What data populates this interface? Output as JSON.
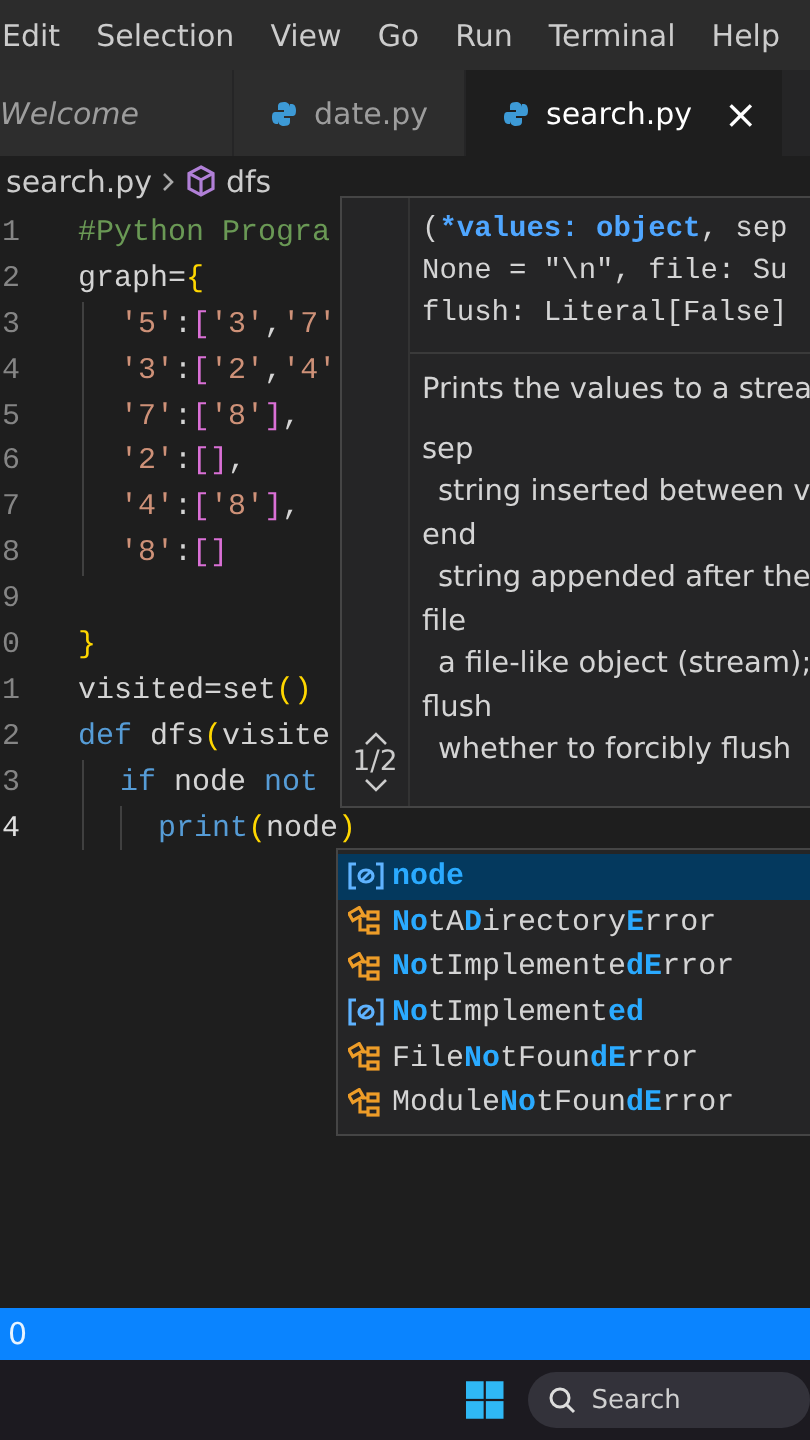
{
  "menu": [
    "Edit",
    "Selection",
    "View",
    "Go",
    "Run",
    "Terminal",
    "Help"
  ],
  "tabs": [
    {
      "label": "Welcome",
      "kind": "preview",
      "selected": false,
      "closable": false
    },
    {
      "label": "date.py",
      "kind": "python",
      "selected": false,
      "closable": false
    },
    {
      "label": "search.py",
      "kind": "python",
      "selected": true,
      "closable": true,
      "close": "×"
    }
  ],
  "breadcrumb": {
    "file": "search.py",
    "symbol": "dfs"
  },
  "code": [
    {
      "number": "1",
      "active": false,
      "kind": "top",
      "tokens": [
        {
          "kind": "comment",
          "text": "#Python Progra"
        }
      ]
    },
    {
      "number": "2",
      "active": false,
      "kind": "top",
      "tokens": [
        {
          "kind": "plain",
          "text": "graph="
        },
        {
          "kind": "bracket1",
          "text": "{"
        }
      ]
    },
    {
      "number": "3",
      "active": false,
      "kind": "block",
      "tokens": [
        {
          "kind": "string",
          "text": "'5'"
        },
        {
          "kind": "plain",
          "text": ":"
        },
        {
          "kind": "bracket2",
          "text": "["
        },
        {
          "kind": "string",
          "text": "'3'"
        },
        {
          "kind": "plain",
          "text": ","
        },
        {
          "kind": "string",
          "text": "'7'"
        }
      ]
    },
    {
      "number": "4",
      "active": false,
      "kind": "block",
      "tokens": [
        {
          "kind": "string",
          "text": "'3'"
        },
        {
          "kind": "plain",
          "text": ":"
        },
        {
          "kind": "bracket2",
          "text": "["
        },
        {
          "kind": "string",
          "text": "'2'"
        },
        {
          "kind": "plain",
          "text": ","
        },
        {
          "kind": "string",
          "text": "'4'"
        }
      ]
    },
    {
      "number": "5",
      "active": false,
      "kind": "block",
      "tokens": [
        {
          "kind": "string",
          "text": "'7'"
        },
        {
          "kind": "plain",
          "text": ":"
        },
        {
          "kind": "bracket2",
          "text": "["
        },
        {
          "kind": "string",
          "text": "'8'"
        },
        {
          "kind": "bracket2",
          "text": "]"
        },
        {
          "kind": "plain",
          "text": ","
        }
      ]
    },
    {
      "number": "6",
      "active": false,
      "kind": "block",
      "tokens": [
        {
          "kind": "string",
          "text": "'2'"
        },
        {
          "kind": "plain",
          "text": ":"
        },
        {
          "kind": "bracket2",
          "text": "[]"
        },
        {
          "kind": "plain",
          "text": ","
        }
      ]
    },
    {
      "number": "7",
      "active": false,
      "kind": "block",
      "tokens": [
        {
          "kind": "string",
          "text": "'4'"
        },
        {
          "kind": "plain",
          "text": ":"
        },
        {
          "kind": "bracket2",
          "text": "["
        },
        {
          "kind": "string",
          "text": "'8'"
        },
        {
          "kind": "bracket2",
          "text": "]"
        },
        {
          "kind": "plain",
          "text": ","
        }
      ]
    },
    {
      "number": "8",
      "active": false,
      "kind": "block",
      "tokens": [
        {
          "kind": "string",
          "text": "'8'"
        },
        {
          "kind": "plain",
          "text": ":"
        },
        {
          "kind": "bracket2",
          "text": "[]"
        }
      ]
    },
    {
      "number": "9",
      "active": false,
      "kind": "top"
    },
    {
      "number": "0",
      "active": false,
      "kind": "top",
      "tokens": [
        {
          "kind": "bracket1",
          "text": "}"
        }
      ]
    },
    {
      "number": "1",
      "active": false,
      "kind": "top",
      "tokens": [
        {
          "kind": "plain",
          "text": "visited=set"
        },
        {
          "kind": "bracket1",
          "text": "()"
        }
      ]
    },
    {
      "number": "2",
      "active": false,
      "kind": "top",
      "tokens": [
        {
          "kind": "keyword",
          "text": "def"
        },
        {
          "kind": "plain",
          "text": " dfs"
        },
        {
          "kind": "bracket1",
          "text": "("
        },
        {
          "kind": "plain",
          "text": "visite"
        }
      ]
    },
    {
      "number": "3",
      "active": false,
      "kind": "block",
      "tokens": [
        {
          "kind": "keyword",
          "text": "if"
        },
        {
          "kind": "plain",
          "text": " node "
        },
        {
          "kind": "keyword",
          "text": "not"
        }
      ]
    },
    {
      "number": "4",
      "active": true,
      "kind": "nested",
      "tokens": [
        {
          "kind": "keyword",
          "text": "print"
        },
        {
          "kind": "bracket1",
          "text": "("
        },
        {
          "kind": "plain",
          "text": "node"
        },
        {
          "kind": "bracket1",
          "text": ")"
        }
      ]
    }
  ],
  "hover": {
    "signature": [
      [
        {
          "kind": "plain",
          "text": "("
        },
        {
          "kind": "param",
          "text": "*values: object"
        },
        {
          "kind": "plain",
          "text": ", sep"
        }
      ],
      [
        {
          "kind": "plain",
          "text": "None = \"\\n\", file: Su"
        }
      ],
      [
        {
          "kind": "plain",
          "text": "flush: Literal[False]"
        }
      ]
    ],
    "summary": "Prints the values to a strea",
    "params": [
      {
        "name": "sep",
        "description": "string inserted between v"
      },
      {
        "name": "end",
        "description": "string appended after the"
      },
      {
        "name": "file",
        "description": "a file-like object (stream);"
      },
      {
        "name": "flush",
        "description": "whether to forcibly flush"
      }
    ],
    "overload": "1/2"
  },
  "suggestions": [
    {
      "kind": "variable",
      "selected": true,
      "parts": [
        {
          "text": "node",
          "match": true
        }
      ]
    },
    {
      "kind": "class",
      "selected": false,
      "parts": [
        {
          "text": "No",
          "match": true
        },
        {
          "text": "tA",
          "match": false
        },
        {
          "text": "D",
          "match": true
        },
        {
          "text": "irectory",
          "match": false
        },
        {
          "text": "E",
          "match": true
        },
        {
          "text": "rror",
          "match": false
        }
      ]
    },
    {
      "kind": "class",
      "selected": false,
      "parts": [
        {
          "text": "No",
          "match": true
        },
        {
          "text": "tImplemente",
          "match": false
        },
        {
          "text": "dE",
          "match": true
        },
        {
          "text": "rror",
          "match": false
        }
      ]
    },
    {
      "kind": "variable",
      "selected": false,
      "parts": [
        {
          "text": "No",
          "match": true
        },
        {
          "text": "tImplement",
          "match": false
        },
        {
          "text": "ed",
          "match": true
        }
      ]
    },
    {
      "kind": "class",
      "selected": false,
      "parts": [
        {
          "text": "File",
          "match": false
        },
        {
          "text": "No",
          "match": true
        },
        {
          "text": "tFoun",
          "match": false
        },
        {
          "text": "dE",
          "match": true
        },
        {
          "text": "rror",
          "match": false
        }
      ]
    },
    {
      "kind": "class",
      "selected": false,
      "parts": [
        {
          "text": "Module",
          "match": false
        },
        {
          "text": "No",
          "match": true
        },
        {
          "text": "tFoun",
          "match": false
        },
        {
          "text": "dE",
          "match": true
        },
        {
          "text": "rror",
          "match": false
        }
      ]
    }
  ],
  "status_bar": {
    "text": "0"
  },
  "taskbar": {
    "search": "Search"
  }
}
